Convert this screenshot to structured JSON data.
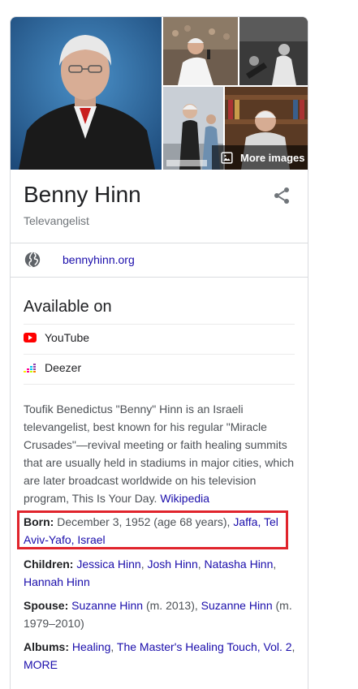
{
  "images": {
    "more_label": "More images"
  },
  "entity": {
    "name": "Benny Hinn",
    "type": "Televangelist"
  },
  "website": {
    "label": "bennyhinn.org"
  },
  "available_on": {
    "title": "Available on",
    "services": [
      {
        "name": "YouTube",
        "icon": "youtube-icon"
      },
      {
        "name": "Deezer",
        "icon": "deezer-icon"
      }
    ]
  },
  "description": {
    "text": "Toufik Benedictus \"Benny\" Hinn is an Israeli televangelist, best known for his regular \"Miracle Crusades\"—revival meeting or faith healing summits that are usually held in stadiums in major cities, which are later broadcast worldwide on his television program, This Is Your Day.",
    "source": "Wikipedia"
  },
  "facts": {
    "born": {
      "label": "Born:",
      "date": "December 3, 1952 (age 68 years),",
      "place": "Jaffa, Tel Aviv-Yafo, Israel"
    },
    "children": {
      "label": "Children:",
      "names": [
        "Jessica Hinn",
        "Josh Hinn",
        "Natasha Hinn",
        "Hannah Hinn"
      ]
    },
    "spouse": {
      "label": "Spouse:",
      "entries": [
        {
          "name": "Suzanne Hinn",
          "detail": "(m. 2013),"
        },
        {
          "name": "Suzanne Hinn",
          "detail": "(m. 1979–2010)"
        }
      ]
    },
    "albums": {
      "label": "Albums:",
      "items": [
        "Healing",
        "The Master's Healing Touch, Vol. 2"
      ],
      "more": "MORE"
    }
  },
  "colors": {
    "link": "#1a0dab",
    "highlight": "#e0242c",
    "youtube": "#ff0000"
  }
}
